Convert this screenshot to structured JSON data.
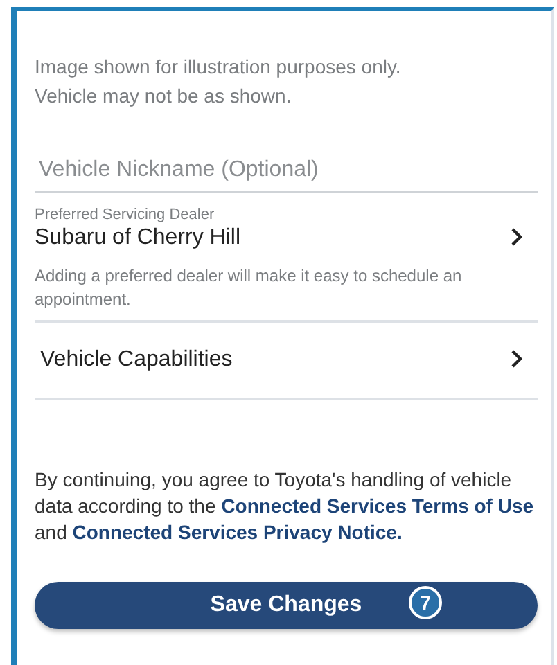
{
  "disclaimer": "Image shown for illustration purposes only.\nVehicle may not be as shown.",
  "nickname_field": {
    "placeholder": "Vehicle Nickname (Optional)"
  },
  "dealer": {
    "label": "Preferred Servicing Dealer",
    "name": "Subaru of Cherry Hill",
    "helper": "Adding a preferred dealer will make it easy to schedule an appointment."
  },
  "menu_items": [
    {
      "label": "Vehicle Capabilities"
    }
  ],
  "legal": [
    {
      "kind": "text",
      "text": "By continuing, you agree to Toyota's handling of vehicle data according to the "
    },
    {
      "kind": "link",
      "text": "Connected Services Terms of Use"
    },
    {
      "kind": "text",
      "text": " and "
    },
    {
      "kind": "link",
      "text": "Connected Services Privacy Notice."
    }
  ],
  "save_button": {
    "label": "Save Changes",
    "badge": "7"
  }
}
